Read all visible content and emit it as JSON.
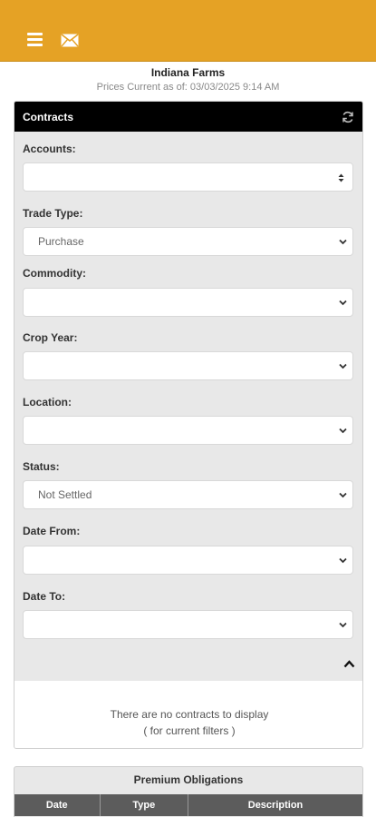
{
  "company_name": "Indiana Farms",
  "prices_current": "Prices Current as of: 03/03/2025 9:14 AM",
  "contracts_panel": {
    "title": "Contracts",
    "fields": {
      "accounts": {
        "label": "Accounts:",
        "value": ""
      },
      "trade_type": {
        "label": "Trade Type:",
        "value": "Purchase"
      },
      "commodity": {
        "label": "Commodity:",
        "value": ""
      },
      "crop_year": {
        "label": "Crop Year:",
        "value": ""
      },
      "location": {
        "label": "Location:",
        "value": ""
      },
      "status": {
        "label": "Status:",
        "value": "Not Settled"
      },
      "date_from": {
        "label": "Date From:",
        "value": ""
      },
      "date_to": {
        "label": "Date To:",
        "value": ""
      }
    },
    "empty_message": "There are no contracts to display",
    "empty_sub": "( for current filters )"
  },
  "premium_obligations": {
    "title": "Premium Obligations",
    "columns": [
      "Date",
      "Type",
      "Description"
    ]
  },
  "icons": [
    "menu-icon",
    "mail-icon",
    "refresh-icon",
    "chevron-down-icon",
    "chevron-up-icon",
    "sort-arrows-icon"
  ],
  "colors": {
    "accent": "#e5a225",
    "panel_header": "#000000",
    "table_header": "#5c5c5c"
  }
}
